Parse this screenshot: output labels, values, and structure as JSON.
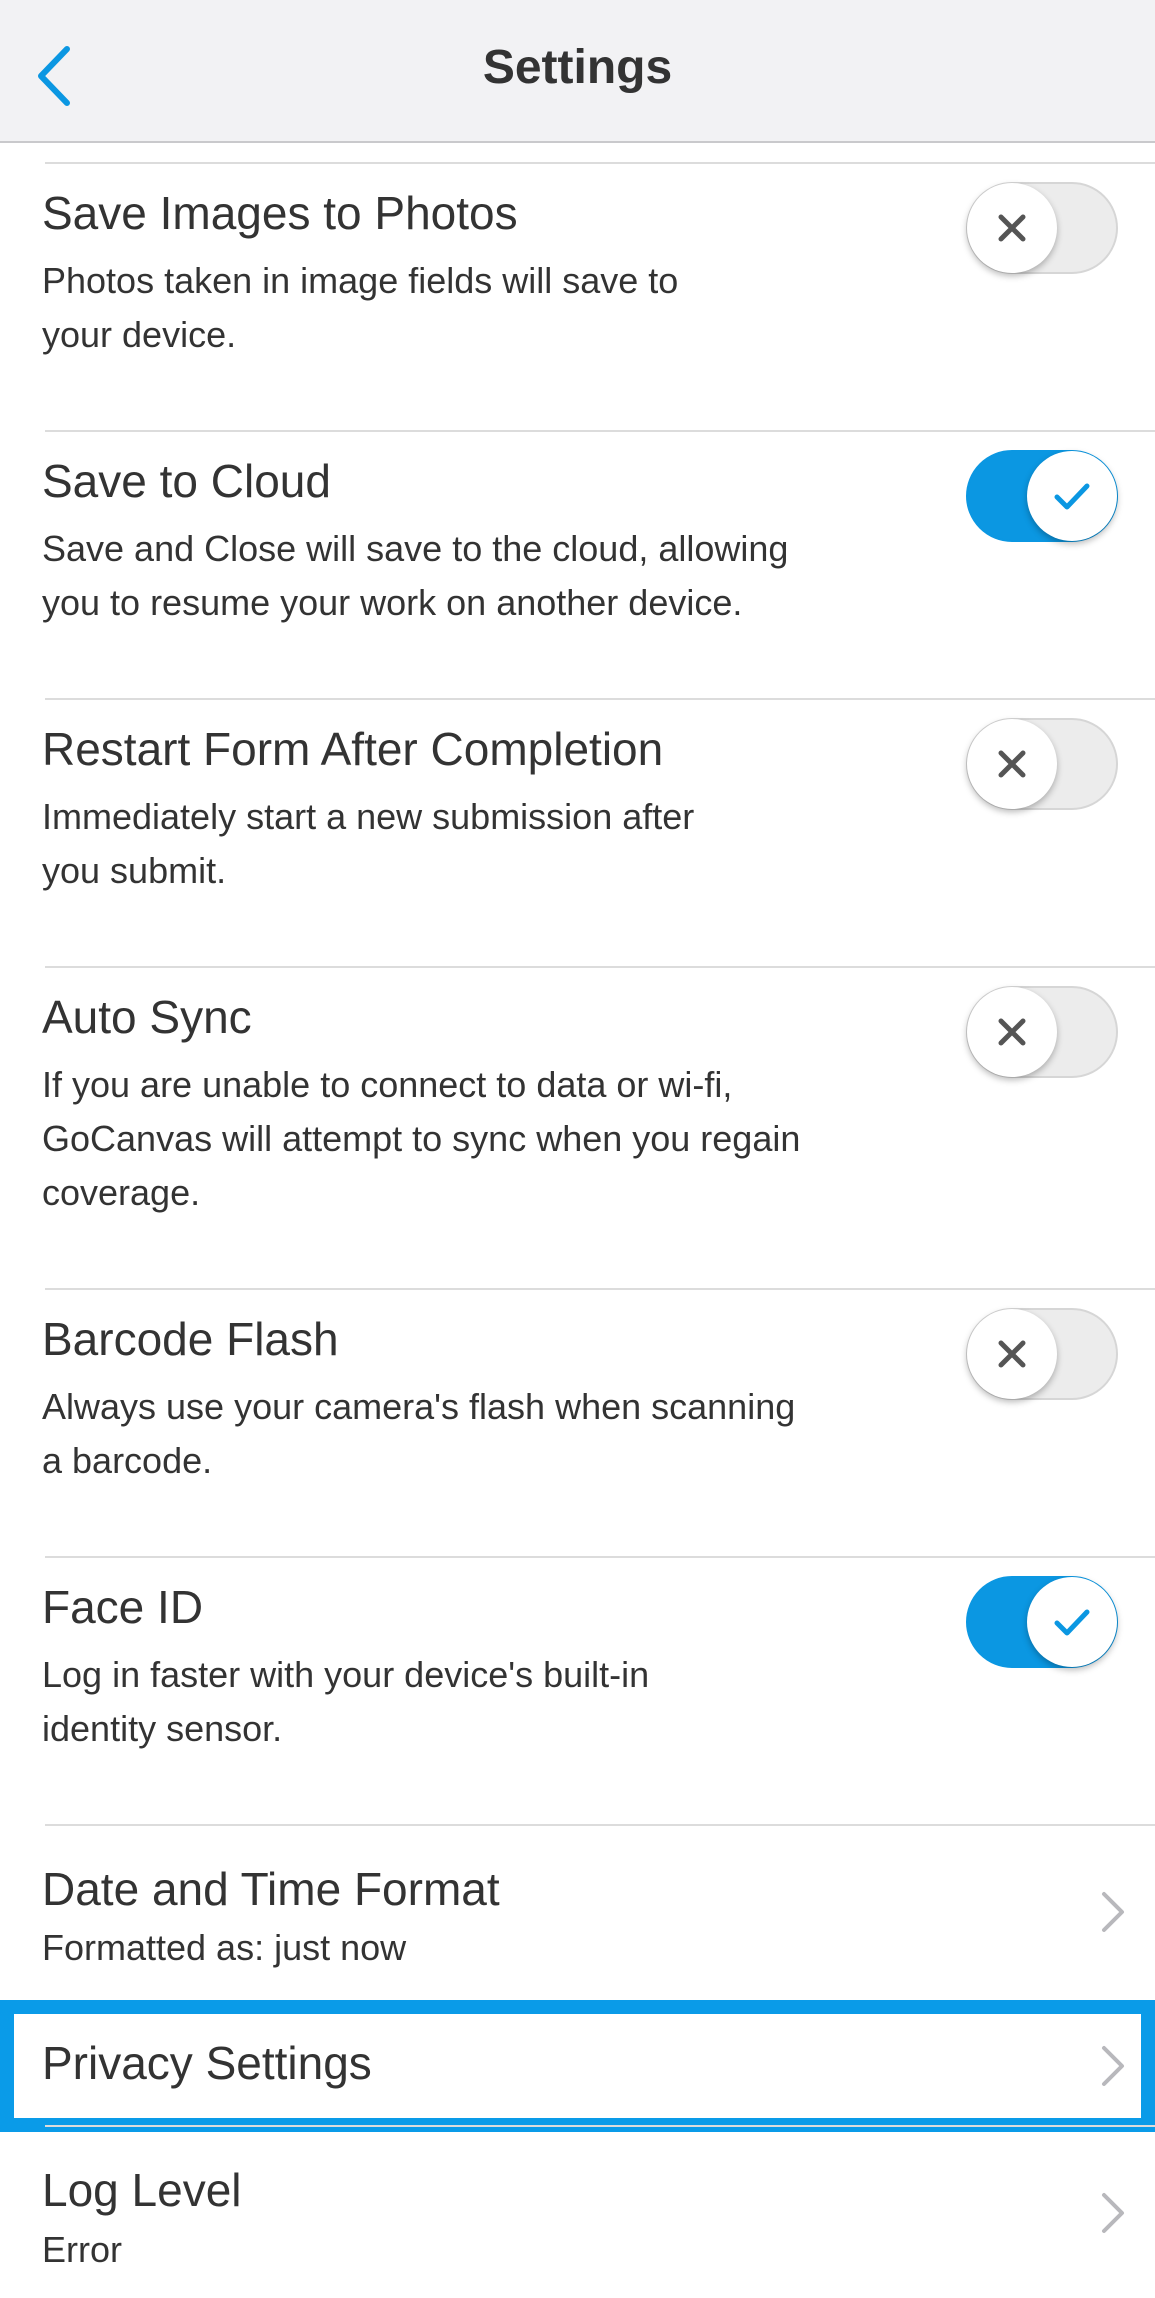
{
  "header": {
    "title": "Settings",
    "back_icon": "chevron-left-icon"
  },
  "colors": {
    "accent": "#0b97e2",
    "highlight": "#0a9be8",
    "toggle_off": "#ececec",
    "text": "#333333",
    "divider": "#dcdcdc"
  },
  "settings": {
    "save_images": {
      "title": "Save Images to Photos",
      "desc_line1": "Photos taken in image fields will save to",
      "desc_line2": "your device.",
      "enabled": false
    },
    "save_cloud": {
      "title": "Save to Cloud",
      "desc_line1": "Save and Close will save to the cloud, allowing",
      "desc_line2": "you to resume your work on another device.",
      "enabled": true
    },
    "restart_form": {
      "title": "Restart Form After Completion",
      "desc_line1": "Immediately start a new submission after",
      "desc_line2": "you submit.",
      "enabled": false
    },
    "auto_sync": {
      "title": "Auto Sync",
      "desc_line1": "If you are unable to connect to data or wi-fi,",
      "desc_line2": "GoCanvas will attempt to sync when you regain",
      "desc_line3": "coverage.",
      "enabled": false
    },
    "barcode_flash": {
      "title": "Barcode Flash",
      "desc_line1": "Always use your camera's flash when scanning",
      "desc_line2": "a barcode.",
      "enabled": false
    },
    "face_id": {
      "title": "Face ID",
      "desc_line1": "Log in faster with your device's built-in",
      "desc_line2": "identity sensor.",
      "enabled": true
    },
    "date_time": {
      "title": "Date and Time Format",
      "subtitle": "Formatted as: just now"
    },
    "privacy": {
      "title": "Privacy Settings",
      "selected": true
    },
    "log_level": {
      "title": "Log Level",
      "subtitle": "Error"
    }
  }
}
